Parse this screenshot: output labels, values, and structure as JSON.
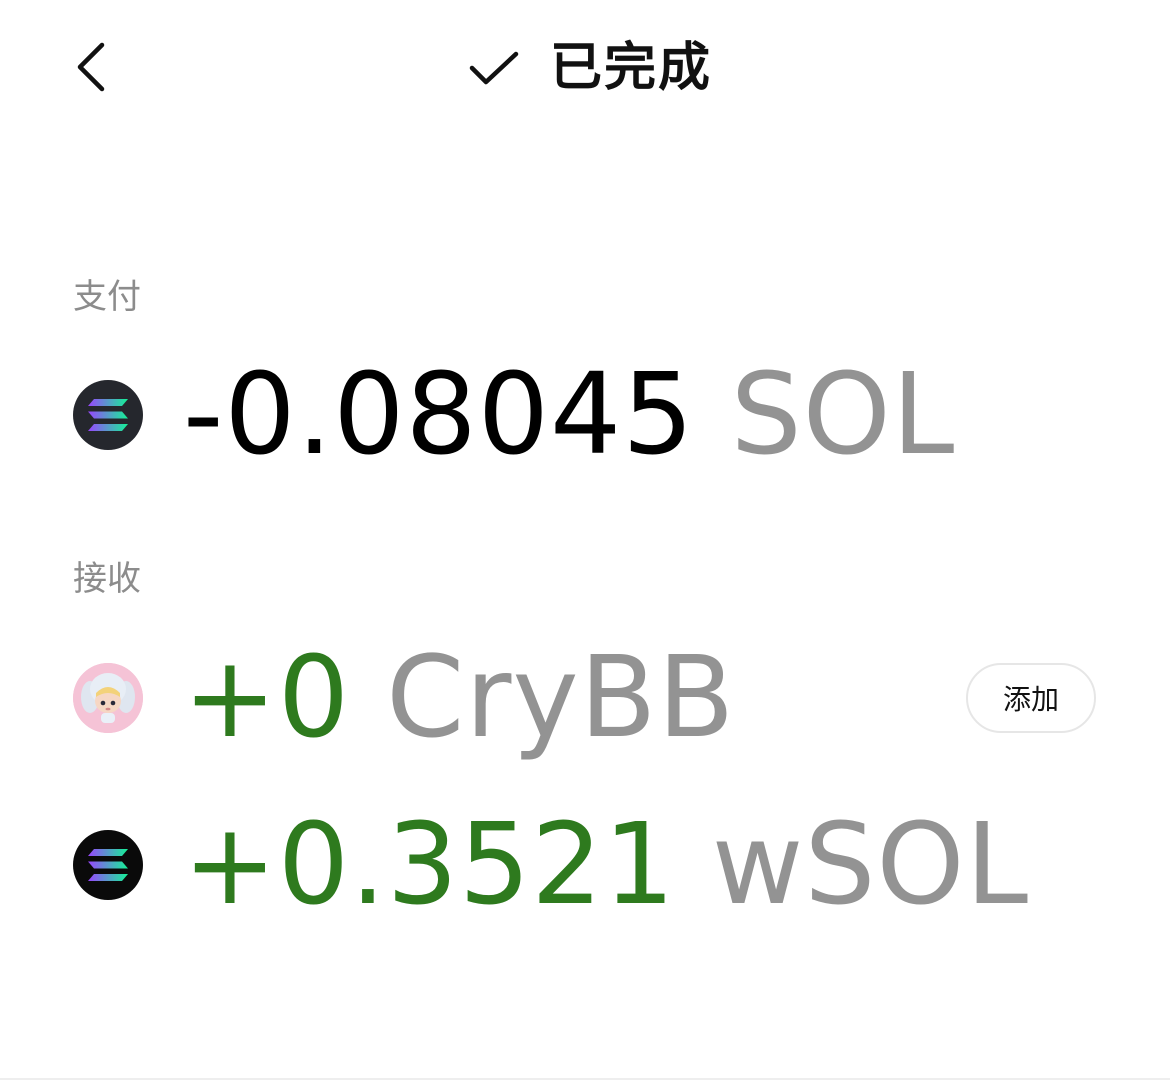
{
  "header": {
    "back_icon": "chevron-left-icon",
    "status_icon": "checkmark-icon",
    "status_text": "已完成"
  },
  "pay": {
    "label": "支付",
    "items": [
      {
        "icon": "solana-icon",
        "amount": "-0.08045",
        "symbol": "SOL"
      }
    ]
  },
  "receive": {
    "label": "接收",
    "items": [
      {
        "icon": "crybb-avatar-icon",
        "amount": "+0",
        "symbol": "CryBB",
        "action_label": "添加"
      },
      {
        "icon": "solana-icon",
        "amount": "+0.3521",
        "symbol": "wSOL"
      }
    ]
  },
  "colors": {
    "positive": "#2e7a1e",
    "negative": "#000000",
    "symbol": "#939393",
    "label": "#8c8c8c"
  }
}
